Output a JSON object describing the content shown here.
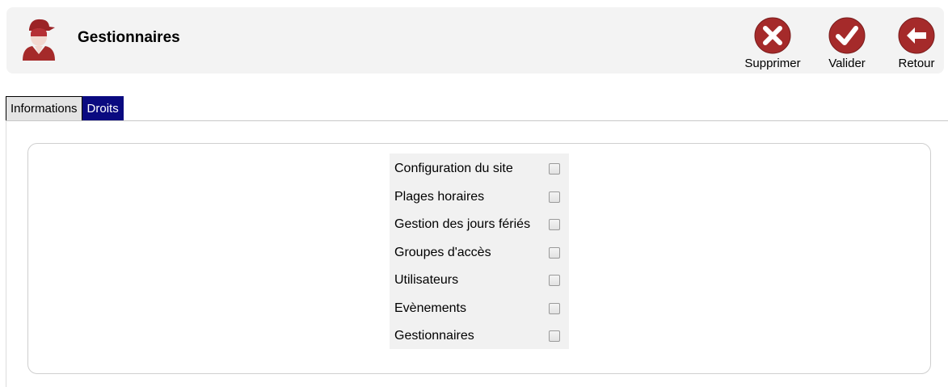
{
  "header": {
    "title": "Gestionnaires",
    "actions": {
      "delete_label": "Supprimer",
      "validate_label": "Valider",
      "back_label": "Retour"
    }
  },
  "tabs": [
    {
      "label": "Informations",
      "active": false
    },
    {
      "label": "Droits",
      "active": true
    }
  ],
  "rights": [
    {
      "label": "Configuration du site",
      "checked": false
    },
    {
      "label": "Plages horaires",
      "checked": false
    },
    {
      "label": "Gestion des jours fériés",
      "checked": false
    },
    {
      "label": "Groupes d'accès",
      "checked": false
    },
    {
      "label": "Utilisateurs",
      "checked": false
    },
    {
      "label": "Evènements",
      "checked": false
    },
    {
      "label": "Gestionnaires",
      "checked": false
    }
  ],
  "colors": {
    "action_red": "#a52a2a",
    "active_tab": "#0a0a80"
  }
}
